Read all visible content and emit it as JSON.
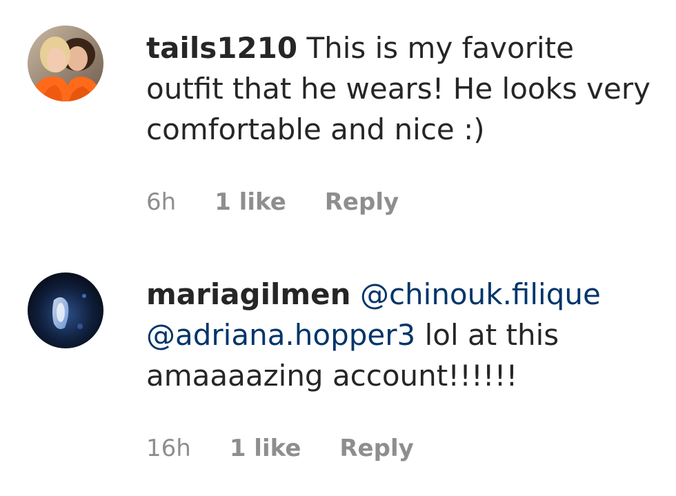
{
  "comments": [
    {
      "username": "tails1210",
      "text_parts": [
        " This is my favorite outfit that he wears! He looks very comfortable and nice :)"
      ],
      "time": "6h",
      "likes": "1 like",
      "reply_label": "Reply",
      "avatar_icon": "profile-photo-two-people-orange"
    },
    {
      "username": "mariagilmen",
      "mentions": [
        "@chinouk.filique",
        "@adriana.hopper3"
      ],
      "text_after": " lol at this amaaaazing account!!!!!!",
      "time": "16h",
      "likes": "1 like",
      "reply_label": "Reply",
      "avatar_icon": "profile-photo-dark-blue"
    }
  ],
  "colors": {
    "text": "#262626",
    "meta": "#8e8e8e",
    "mention": "#003569",
    "background": "#ffffff"
  }
}
